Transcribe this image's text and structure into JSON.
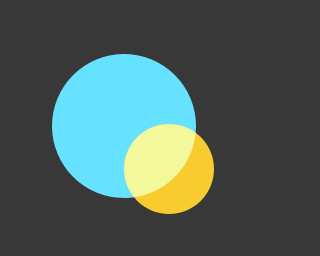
{
  "icon": {
    "name": "overlapping-circles-icon",
    "colors": {
      "background": "#383838",
      "large_circle": "#66E2FF",
      "small_circle": "#F8CB2E",
      "overlap": "#F3F89D"
    }
  }
}
